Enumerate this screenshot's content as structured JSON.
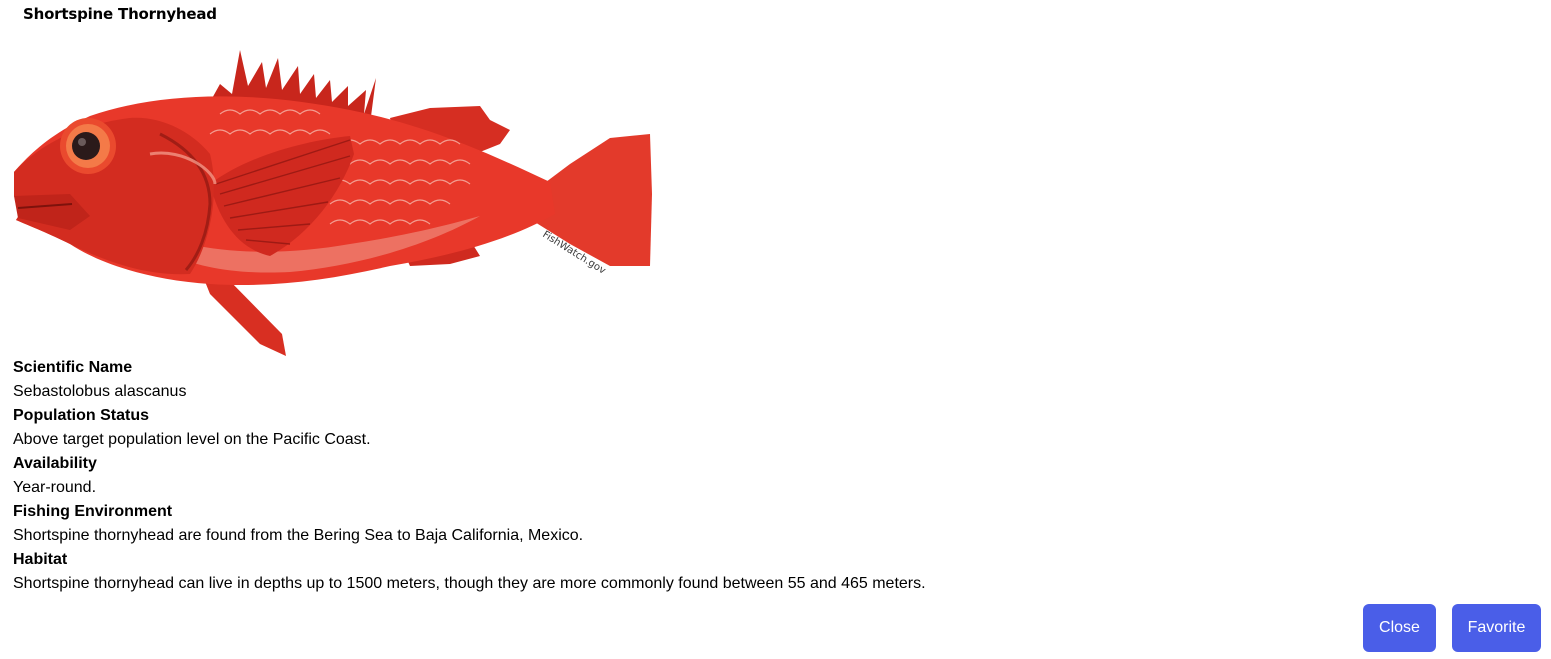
{
  "title": "Shortspine Thornyhead",
  "image": {
    "watermark": "FishWatch.gov",
    "colors": {
      "body": "#e8382a",
      "dark": "#b51d17",
      "light": "#f4a89a"
    }
  },
  "details": [
    {
      "label": "Scientific Name",
      "value": "Sebastolobus alascanus"
    },
    {
      "label": "Population Status",
      "value": "Above target population level on the Pacific Coast."
    },
    {
      "label": "Availability",
      "value": "Year-round."
    },
    {
      "label": "Fishing Environment",
      "value": "Shortspine thornyhead are found from the Bering Sea to Baja California, Mexico."
    },
    {
      "label": "Habitat",
      "value": "Shortspine thornyhead can live in depths up to 1500 meters, though they are more commonly found between 55 and 465 meters."
    }
  ],
  "buttons": {
    "close_label": "Close",
    "favorite_label": "Favorite",
    "accent": "#4a5ee8"
  }
}
